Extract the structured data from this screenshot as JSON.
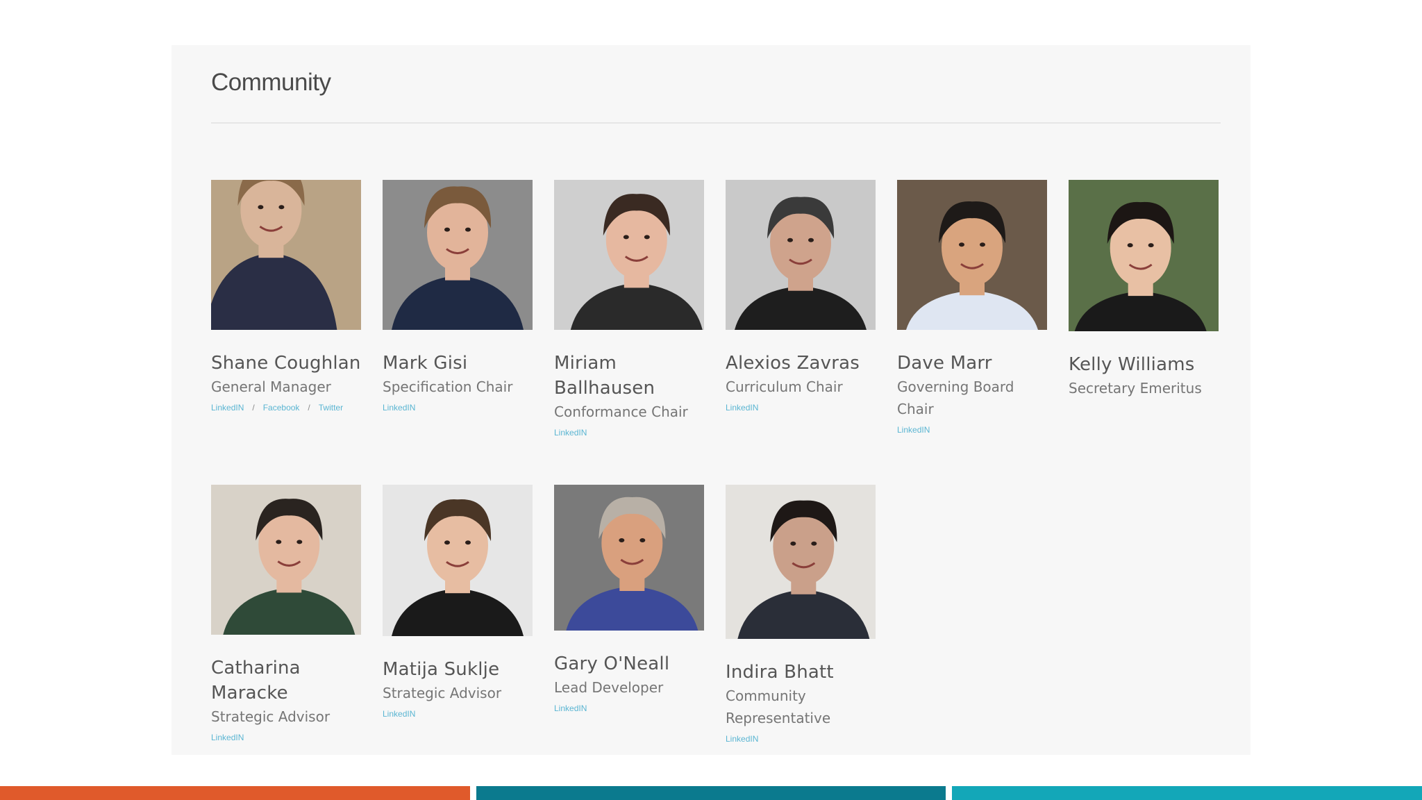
{
  "section": {
    "title": "Community"
  },
  "members": [
    {
      "name": "Shane Coughlan",
      "role": "General Manager",
      "links": [
        "LinkedIN",
        "Facebook",
        "Twitter"
      ],
      "photo": "portrait-speaker-suit"
    },
    {
      "name": "Mark Gisi",
      "role": "Specification Chair",
      "links": [
        "LinkedIN"
      ],
      "photo": "portrait-man-glasses"
    },
    {
      "name": "Miriam Ballhausen",
      "role": "Conformance Chair",
      "links": [
        "LinkedIN"
      ],
      "photo": "portrait-woman-smiling"
    },
    {
      "name": "Alexios Zavras",
      "role": "Curriculum Chair",
      "links": [
        "LinkedIN"
      ],
      "photo": "portrait-man-beard-glasses"
    },
    {
      "name": "Dave Marr",
      "role": "Governing Board Chair",
      "links": [
        "LinkedIN"
      ],
      "photo": "portrait-man-white-shirt"
    },
    {
      "name": "Kelly Williams",
      "role": "Secretary Emeritus",
      "links": [],
      "photo": "portrait-woman-long-hair"
    },
    {
      "name": "Catharina Maracke",
      "role": "Strategic Advisor",
      "links": [
        "LinkedIN"
      ],
      "photo": "portrait-woman-scarf"
    },
    {
      "name": "Matija Suklje",
      "role": "Strategic Advisor",
      "links": [
        "LinkedIN"
      ],
      "photo": "portrait-man-suit-tie"
    },
    {
      "name": "Gary O'Neall",
      "role": "Lead Developer",
      "links": [
        "LinkedIN"
      ],
      "photo": "portrait-man-grey-hair"
    },
    {
      "name": "Indira Bhatt",
      "role": "Community Representative",
      "links": [
        "LinkedIN"
      ],
      "photo": "portrait-woman-dark-hair"
    }
  ],
  "colors": {
    "accent_orange": "#e05a2b",
    "accent_teal_dark": "#0b7a8e",
    "accent_teal_light": "#13a7b8",
    "link": "#5ab5d2"
  }
}
